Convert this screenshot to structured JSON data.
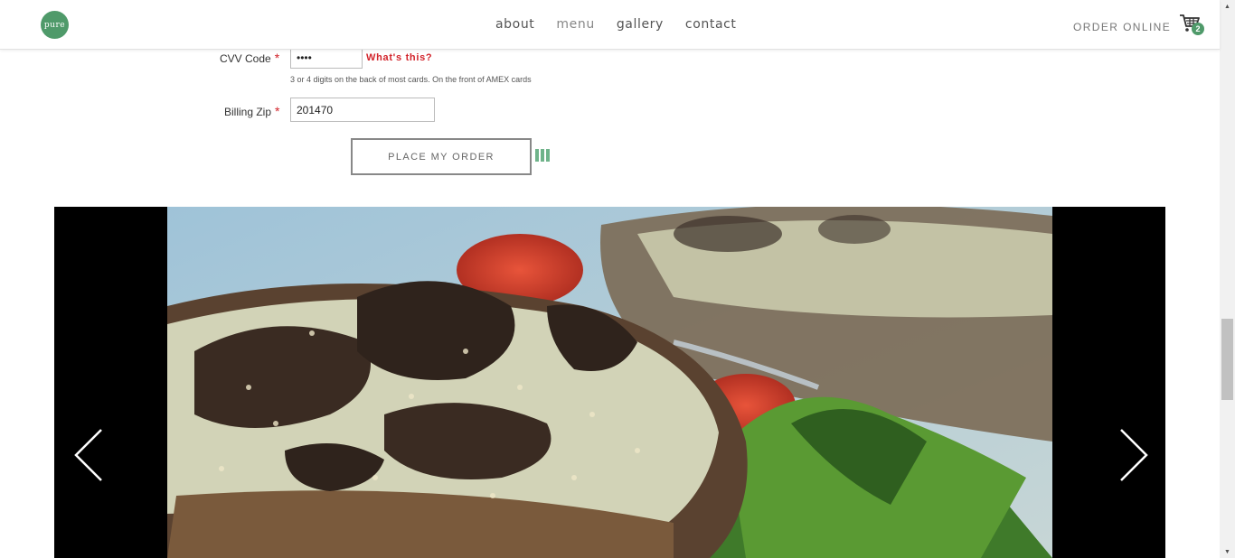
{
  "header": {
    "logo_text": "pure",
    "nav": [
      {
        "label": "about"
      },
      {
        "label": "menu"
      },
      {
        "label": "gallery"
      },
      {
        "label": "contact"
      }
    ],
    "order_online": "ORDER ONLINE",
    "cart_count": "2"
  },
  "form": {
    "cvv_label": "CVV Code",
    "cvv_value": "••••",
    "whats_this": "What's this?",
    "cvv_hint": "3 or 4 digits on the back of most cards. On the front of AMEX cards",
    "zip_label": "Billing Zip",
    "zip_value": "201470",
    "required_mark": "*",
    "submit_label": "PLACE MY ORDER"
  },
  "colors": {
    "brand_green": "#4f9a6a",
    "required_red": "#d2232a"
  },
  "icons": {
    "cart": "shopping-cart-icon",
    "prev": "chevron-left-icon",
    "next": "chevron-right-icon"
  }
}
